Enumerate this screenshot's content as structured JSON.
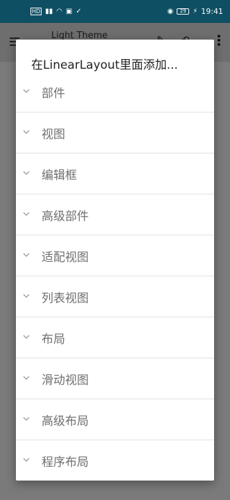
{
  "statusbar": {
    "left_icons": [
      "hd-icon",
      "signal-icon",
      "wifi-icon",
      "app-icon",
      "check-icon"
    ],
    "battery": "29",
    "time": "19:41"
  },
  "appbar": {
    "title": "Light Theme"
  },
  "dialog": {
    "title": "在LinearLayout里面添加...",
    "items": [
      {
        "label": "部件"
      },
      {
        "label": "视图"
      },
      {
        "label": "编辑框"
      },
      {
        "label": "高级部件"
      },
      {
        "label": "适配视图"
      },
      {
        "label": "列表视图"
      },
      {
        "label": "布局"
      },
      {
        "label": "滑动视图"
      },
      {
        "label": "高级布局"
      },
      {
        "label": "程序布局"
      }
    ]
  }
}
